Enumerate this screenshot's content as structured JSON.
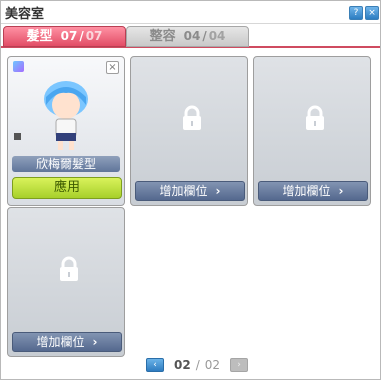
{
  "window": {
    "title": "美容室"
  },
  "title_buttons": {
    "help": "?",
    "close": "×"
  },
  "tabs": [
    {
      "label": "髮型",
      "used": "07",
      "total": "07",
      "active": true
    },
    {
      "label": "整容",
      "used": "04",
      "total": "04",
      "active": false
    }
  ],
  "slot_card": {
    "name": "欣梅爾髮型",
    "apply_label": "應用",
    "close_glyph": "×"
  },
  "empty_slot": {
    "label": "增加欄位",
    "arrow": "›"
  },
  "pager": {
    "prev": "‹",
    "next": "›",
    "current": "02",
    "separator": "/",
    "total": "02"
  },
  "colors": {
    "active_tab": "#e24d66",
    "apply_button": "#a7d02a",
    "slot_button": "#54688e"
  }
}
